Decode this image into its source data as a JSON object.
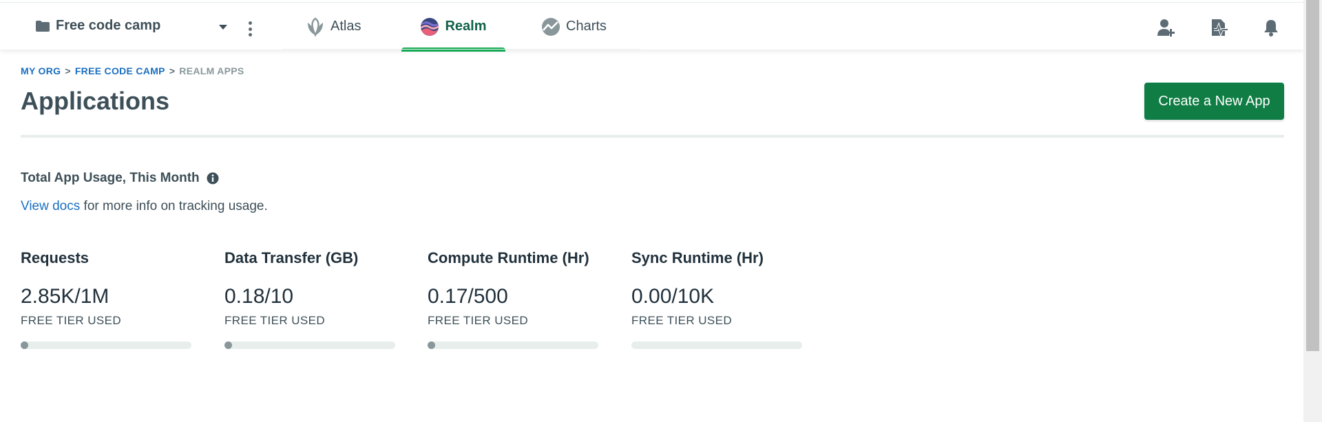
{
  "header": {
    "project_name": "Free code camp",
    "tabs": [
      {
        "label": "Atlas",
        "active": false
      },
      {
        "label": "Realm",
        "active": true
      },
      {
        "label": "Charts",
        "active": false
      }
    ],
    "icons": [
      "invite-user-icon",
      "activity-feed-icon",
      "bell-icon"
    ]
  },
  "breadcrumb": {
    "org": "MY ORG",
    "sep1": ">",
    "project": "FREE CODE CAMP",
    "sep2": ">",
    "current": "REALM APPS"
  },
  "page": {
    "title": "Applications",
    "create_button": "Create a New App"
  },
  "usage": {
    "title": "Total App Usage, This Month",
    "docs_link": "View docs",
    "docs_rest": " for more info on tracking usage.",
    "metrics": [
      {
        "label": "Requests",
        "value": "2.85K/1M",
        "sub": "FREE TIER USED",
        "fraction": 0.00285
      },
      {
        "label": "Data Transfer (GB)",
        "value": "0.18/10",
        "sub": "FREE TIER USED",
        "fraction": 0.018
      },
      {
        "label": "Compute Runtime (Hr)",
        "value": "0.17/500",
        "sub": "FREE TIER USED",
        "fraction": 0.00034
      },
      {
        "label": "Sync Runtime (Hr)",
        "value": "0.00/10K",
        "sub": "FREE TIER USED",
        "fraction": 0
      }
    ]
  },
  "colors": {
    "accent_green": "#13aa52",
    "button_green": "#0f7d44",
    "link_blue": "#1a6fc0"
  }
}
